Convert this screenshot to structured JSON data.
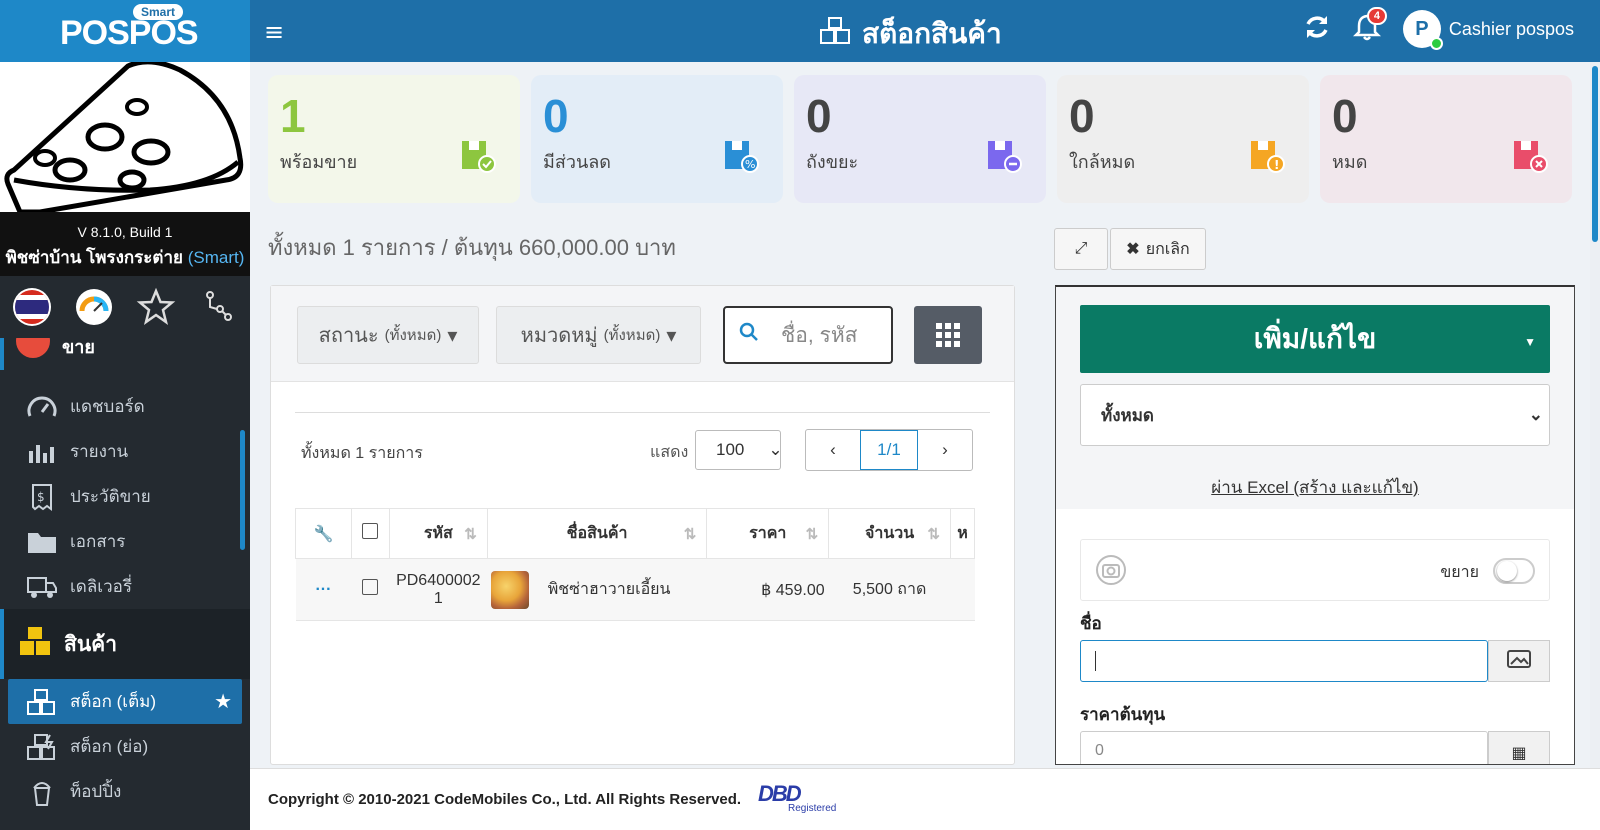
{
  "brand": {
    "logo": "POSPOS",
    "badge": "Smart",
    "version": "V 8.1.0, Build 1",
    "shop": "พิชซ่าบ้าน โพรงกระต่าย",
    "shop_tag": "(Smart)"
  },
  "sidebar": {
    "partial_section": "ขาย",
    "items": [
      {
        "label": "แดชบอร์ด",
        "icon": "dashboard-icon"
      },
      {
        "label": "รายงาน",
        "icon": "report-icon"
      },
      {
        "label": "ประวัติขาย",
        "icon": "receipt-icon"
      },
      {
        "label": "เอกสาร",
        "icon": "folder-icon"
      },
      {
        "label": "เดลิเวอรี่",
        "icon": "truck-icon"
      }
    ],
    "group": "สินค้า",
    "sub_items": [
      {
        "label": "สต็อก (เต็ม)",
        "icon": "stock-full-icon",
        "active": true
      },
      {
        "label": "สต็อก (ย่อ)",
        "icon": "stock-short-icon"
      },
      {
        "label": "ท็อปปิ้ง",
        "icon": "topping-icon"
      }
    ]
  },
  "header": {
    "title": "สต็อกสินค้า",
    "notifications": "4",
    "user": "Cashier pospos",
    "avatar_letter": "P"
  },
  "stats": [
    {
      "value": "1",
      "label": "พร้อมขาย",
      "color": "#8dc63f",
      "bg": "#f3f7ea"
    },
    {
      "value": "0",
      "label": "มีส่วนลด",
      "color": "#2a8fd6",
      "bg": "#e3edf7"
    },
    {
      "value": "0",
      "label": "ถังขยะ",
      "color": "#7b68ee",
      "bg": "#e7e8f6"
    },
    {
      "value": "0",
      "label": "ใกล้หมด",
      "color": "#f5a623",
      "bg": "#eeeeee"
    },
    {
      "value": "0",
      "label": "หมด",
      "color": "#e94d6a",
      "bg": "#f1e7ec"
    }
  ],
  "summary": "ทั้งหมด 1 รายการ / ต้นทุน 660,000.00 บาท",
  "toolbar": {
    "cancel": "ยกเลิก"
  },
  "filters": {
    "status": "สถานะ",
    "status_sub": "(ทั้งหมด)",
    "category": "หมวดหมู่",
    "category_sub": "(ทั้งหมด)",
    "search_placeholder": "ชื่อ, รหัส"
  },
  "list": {
    "total": "ทั้งหมด 1 รายการ",
    "show": "แสดง",
    "per_page": "100",
    "page": "1/1"
  },
  "table": {
    "headers": {
      "code": "รหัส",
      "name": "ชื่อสินค้า",
      "price": "ราคา",
      "qty": "จำนวน",
      "more": "ห"
    },
    "rows": [
      {
        "code_1": "PD6400002",
        "code_2": "1",
        "name": "พิชซ่าฮาวายเอี้ยน",
        "price": "฿ 459.00",
        "qty": "5,500 ถาด"
      }
    ]
  },
  "form": {
    "main_button": "เพิ่ม/แก้ไข",
    "select": "ทั้งหมด",
    "excel_link": "ผ่าน Excel (สร้าง และแก้ไข)",
    "expand_label": "ขยาย",
    "name_label": "ชื่อ",
    "cost_label": "ราคาต้นทุน",
    "cost_value": "0"
  },
  "footer": {
    "copyright": "Copyright © 2010-2021 CodeMobiles Co., Ltd. All Rights Reserved.",
    "dbd": "DBD",
    "dbd_sub": "Registered"
  }
}
